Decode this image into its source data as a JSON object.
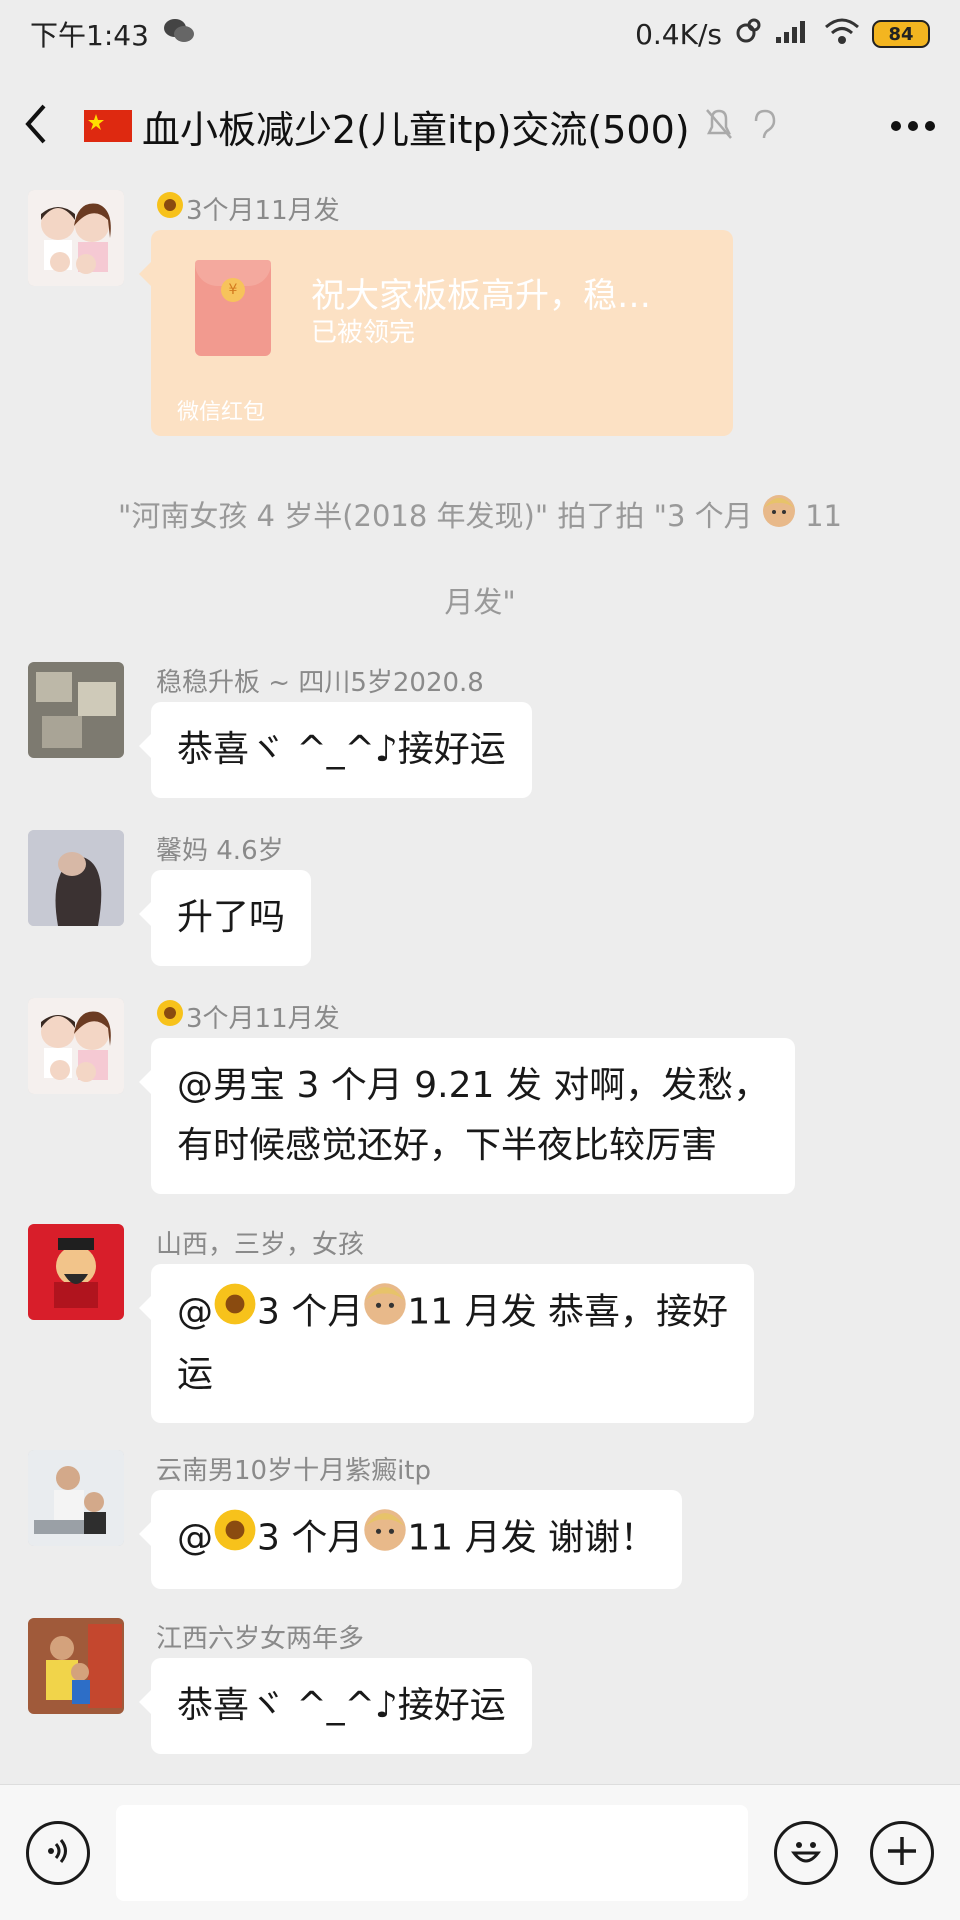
{
  "status_bar": {
    "time": "下午1:43",
    "network_speed": "0.4K/s",
    "battery": "84"
  },
  "header": {
    "title": "血小板减少2(儿童itp)交流(500)"
  },
  "messages": [
    {
      "sender": "3个月11月发",
      "type": "red_packet",
      "red_packet": {
        "title": "祝大家板板高升，稳…",
        "status": "已被领完",
        "brand": "微信红包"
      }
    },
    {
      "type": "system",
      "text_line1": "\"河南女孩 4 岁半(2018 年发现)\" 拍了拍 \"3 个月",
      "text_line1_tail": "11",
      "text_line2": "月发\""
    },
    {
      "sender": "稳稳升板 ~ 四川5岁2020.8",
      "text": "恭喜ヾ ^_^♪接好运"
    },
    {
      "sender": "馨妈 4.6岁",
      "text": "升了吗"
    },
    {
      "sender": "3个月11月发",
      "text_line1": "@男宝 3 个月 9.21 发  对啊，发愁，",
      "text_line2": "有时候感觉还好，下半夜比较厉害"
    },
    {
      "sender": "山西，三岁，女孩",
      "text_at": "@",
      "text_mid": "3 个月",
      "text_rest": "11 月发  恭喜，接好",
      "text_line2": "运"
    },
    {
      "sender": "云南男10岁十月紫癜itp",
      "text_at": "@",
      "text_mid": "3 个月",
      "text_rest": "11 月发  谢谢！"
    },
    {
      "sender": "江西六岁女两年多",
      "text": "恭喜ヾ ^_^♪接好运"
    }
  ],
  "icons": {
    "sunflower": "sunflower-emoji",
    "child": "child-face-emoji"
  },
  "colors": {
    "background": "#ededed",
    "red_packet": "#fce1c4",
    "bubble": "#ffffff"
  }
}
